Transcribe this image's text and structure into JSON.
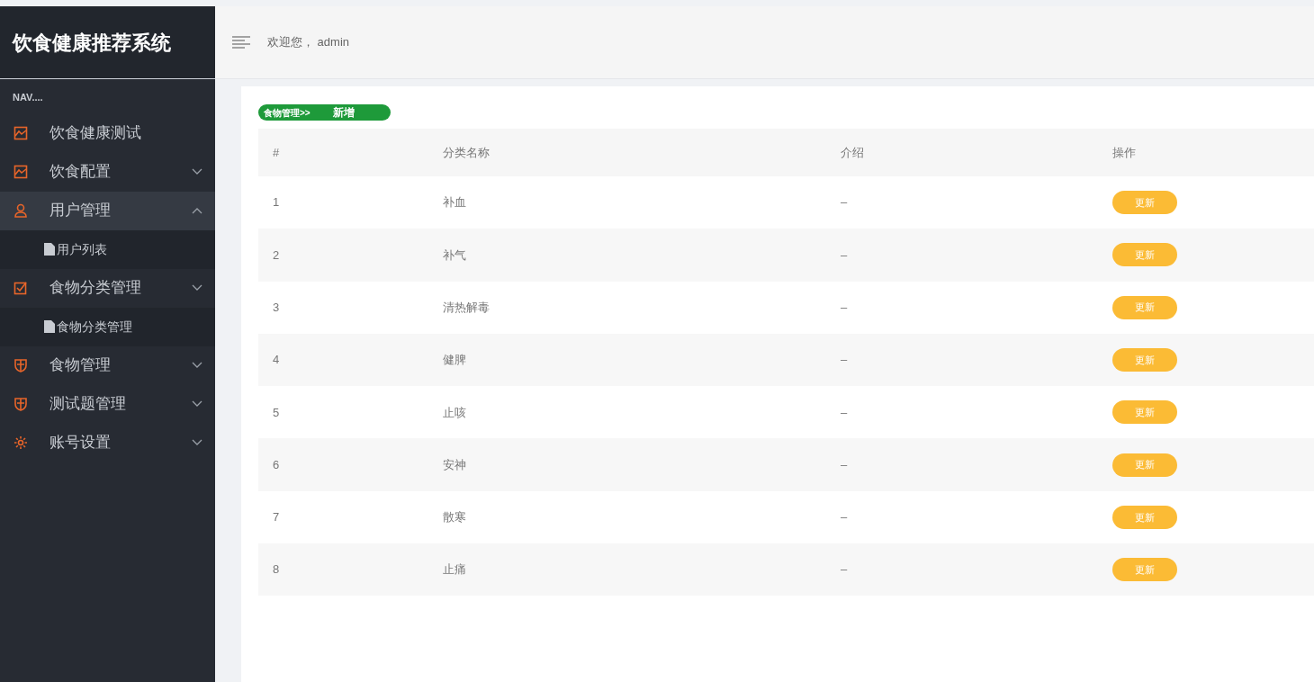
{
  "sidebar": {
    "title": "饮食健康推荐系统",
    "section_label": "NAV....",
    "items": [
      {
        "label": "饮食健康测试",
        "selected": false
      },
      {
        "label": "饮食配置",
        "expanded": false,
        "selected": false
      },
      {
        "label": "用户管理",
        "expanded": true,
        "selected": true,
        "children": [
          {
            "label": "用户列表"
          }
        ]
      },
      {
        "label": "食物分类管理",
        "expanded": false,
        "selected": false,
        "children": [
          {
            "label": "食物分类管理"
          }
        ]
      },
      {
        "label": "食物管理",
        "expanded": false,
        "selected": false
      },
      {
        "label": "测试题管理",
        "expanded": false,
        "selected": false
      },
      {
        "label": "账号设置",
        "expanded": false,
        "selected": false
      }
    ]
  },
  "topbar": {
    "greeting": "欢迎您， admin"
  },
  "breadcrumb": {
    "path": "食物管理>>",
    "action": "新增"
  },
  "table": {
    "columns": [
      "#",
      "分类名称",
      "介绍",
      "操作"
    ],
    "rows": [
      {
        "index": "1",
        "name": "补血",
        "intro": "–",
        "action": "更新"
      },
      {
        "index": "2",
        "name": "补气",
        "intro": "–",
        "action": "更新"
      },
      {
        "index": "3",
        "name": "清热解毒",
        "intro": "–",
        "action": "更新"
      },
      {
        "index": "4",
        "name": "健脾",
        "intro": "–",
        "action": "更新"
      },
      {
        "index": "5",
        "name": "止咳",
        "intro": "–",
        "action": "更新"
      },
      {
        "index": "6",
        "name": "安神",
        "intro": "–",
        "action": "更新"
      },
      {
        "index": "7",
        "name": "散寒",
        "intro": "–",
        "action": "更新"
      },
      {
        "index": "8",
        "name": "止痛",
        "intro": "–",
        "action": "更新"
      }
    ]
  }
}
